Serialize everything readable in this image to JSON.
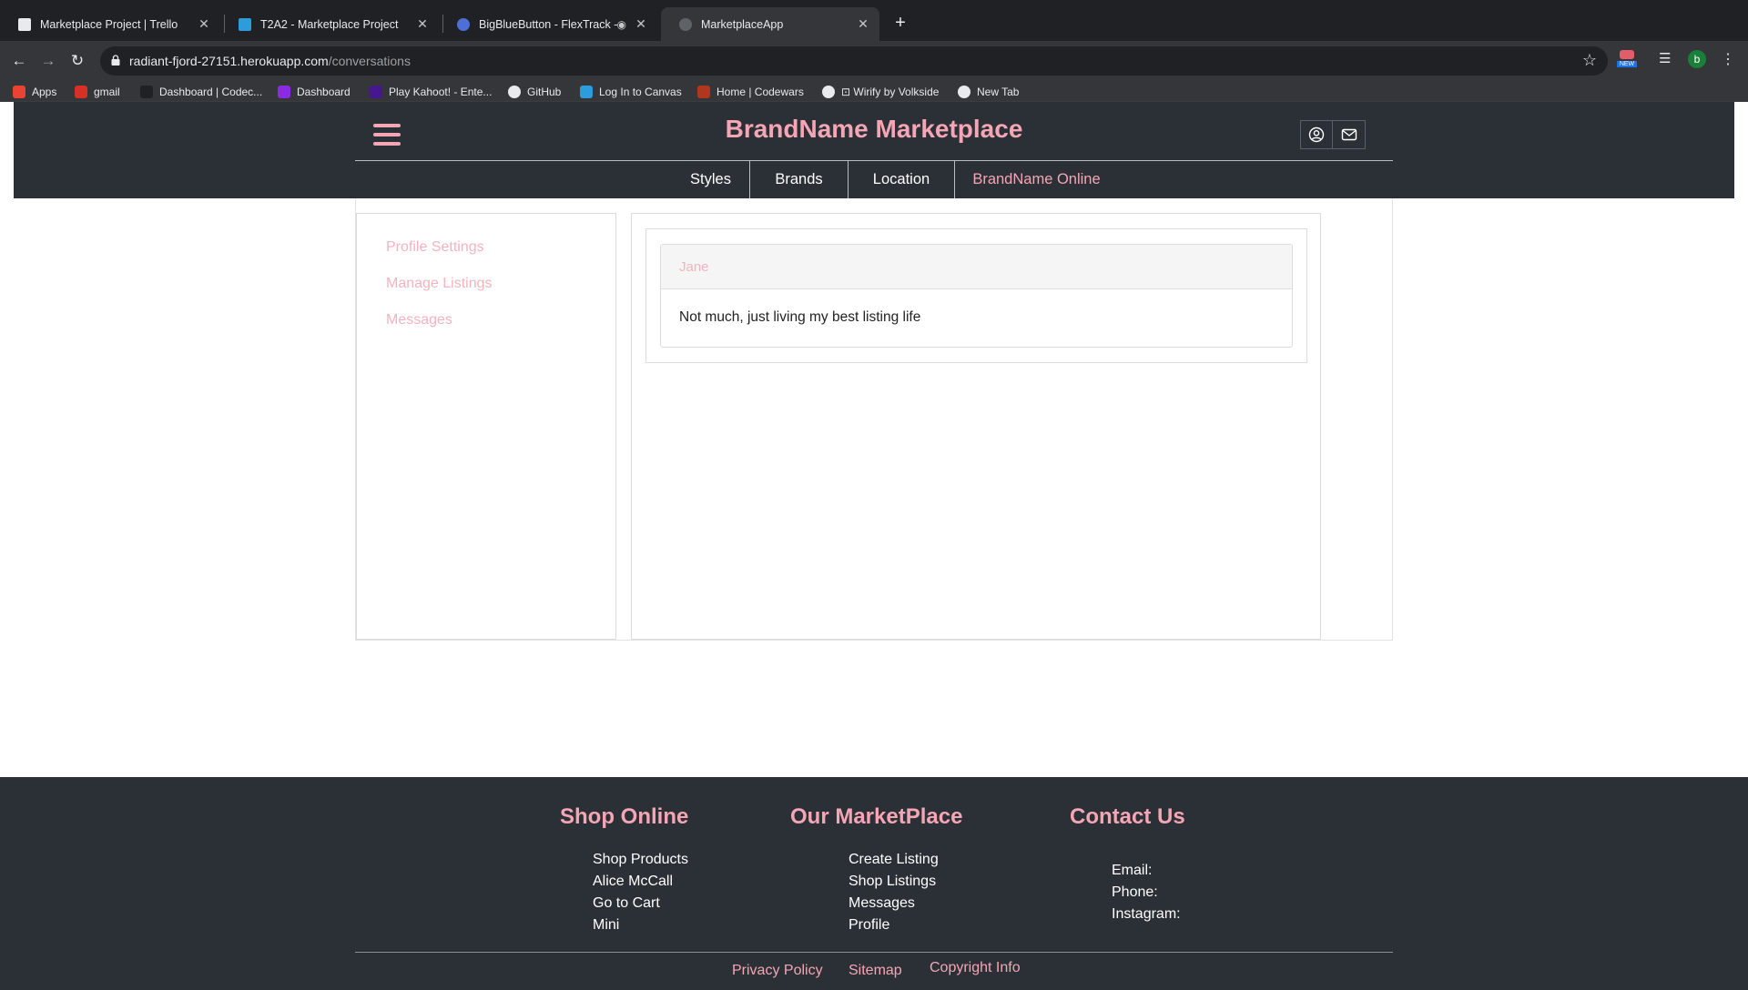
{
  "browser": {
    "tabs": [
      {
        "title": "Marketplace Project | Trello",
        "active": false
      },
      {
        "title": "T2A2 - Marketplace Project",
        "active": false
      },
      {
        "title": "BigBlueButton - FlexTrack - S",
        "active": false
      },
      {
        "title": "MarketplaceApp",
        "active": true
      }
    ],
    "url_host": "radiant-fjord-27151.herokuapp.com",
    "url_path": "/conversations",
    "profile_initial": "b",
    "new_badge": "NEW",
    "bookmarks": [
      {
        "label": "Apps",
        "icon": "apps-grid-icon",
        "color": "#ea4335"
      },
      {
        "label": "gmail",
        "icon": "gmail-icon",
        "color": "#d93025"
      },
      {
        "label": "Dashboard | Codec...",
        "icon": "codecademy-icon",
        "color": "#202124"
      },
      {
        "label": "Dashboard",
        "icon": "ed-icon",
        "color": "#8a2be2"
      },
      {
        "label": "Play Kahoot! - Ente...",
        "icon": "kahoot-icon",
        "color": "#46178f"
      },
      {
        "label": "GitHub",
        "icon": "github-icon",
        "color": "#e8eaed"
      },
      {
        "label": "Log In to Canvas",
        "icon": "canvas-icon",
        "color": "#2d9cdb"
      },
      {
        "label": "Home | Codewars",
        "icon": "codewars-icon",
        "color": "#b1361e"
      },
      {
        "label": "⊡ Wirify by Volkside",
        "icon": "globe-icon",
        "color": "#e8eaed"
      },
      {
        "label": "New Tab",
        "icon": "globe-icon",
        "color": "#e8eaed"
      }
    ]
  },
  "header": {
    "title": "BrandName Marketplace",
    "nav": [
      "Styles",
      "Brands",
      "Location",
      "BrandName Online"
    ]
  },
  "sidebar": {
    "links": [
      "Profile Settings",
      "Manage Listings",
      "Messages"
    ]
  },
  "conversation": {
    "sender": "Jane",
    "message": "Not much, just living my best listing life"
  },
  "footer": {
    "columns": [
      {
        "heading": "Shop Online",
        "links": [
          "Shop Products",
          "Alice McCall",
          "Go to Cart",
          "Mini"
        ]
      },
      {
        "heading": "Our MarketPlace",
        "links": [
          "Create Listing",
          "Shop Listings",
          "Messages",
          "Profile"
        ]
      },
      {
        "heading": "Contact Us",
        "links": [
          "Email:",
          "Phone:",
          "Instagram:"
        ]
      }
    ],
    "bottom_links": [
      "Privacy Policy",
      "Sitemap",
      "Copyright Info"
    ]
  },
  "colors": {
    "accent_pink": "#f4a6b4",
    "header_bg": "#2b2f36",
    "browser_bg": "#202124"
  }
}
